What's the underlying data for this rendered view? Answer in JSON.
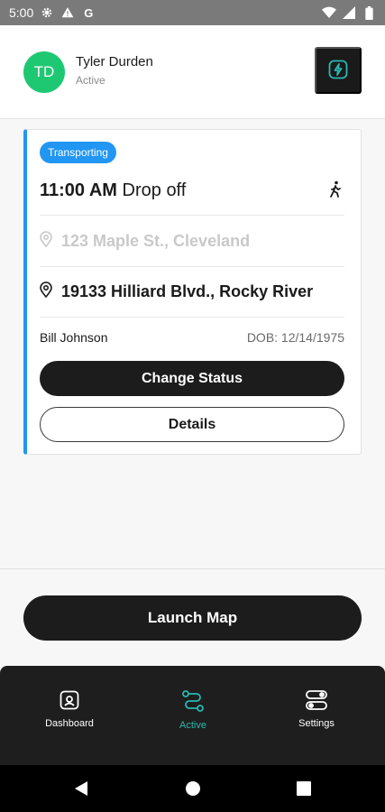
{
  "status_bar": {
    "time": "5:00",
    "left_icons": [
      "gear-icon",
      "warning-icon",
      "google-icon"
    ],
    "right_icons": [
      "wifi-icon",
      "signal-icon",
      "battery-icon"
    ]
  },
  "header": {
    "avatar_initials": "TD",
    "avatar_color": "#1ec872",
    "user_name": "Tyler Durden",
    "user_status": "Active",
    "action_icon": "bolt-icon"
  },
  "trip": {
    "status_badge": "Transporting",
    "status_color": "#2196f3",
    "time": "11:00 AM",
    "type": "Drop off",
    "mode_icon": "walking-icon",
    "pickup_address": "123 Maple St., Cleveland",
    "dropoff_address": "19133 Hilliard Blvd., Rocky River",
    "passenger_name": "Bill Johnson",
    "dob": "DOB: 12/14/1975",
    "change_status_label": "Change Status",
    "details_label": "Details"
  },
  "launch_map_label": "Launch Map",
  "tabs": [
    {
      "label": "Dashboard",
      "icon": "dashboard-icon",
      "active": false
    },
    {
      "label": "Active",
      "icon": "route-icon",
      "active": true
    },
    {
      "label": "Settings",
      "icon": "toggles-icon",
      "active": false
    }
  ],
  "accent_color": "#2ab7b0"
}
